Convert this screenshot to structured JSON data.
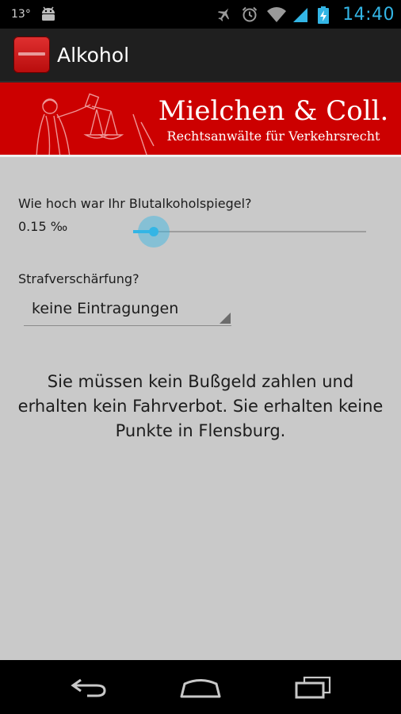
{
  "status_bar": {
    "temperature": "13°",
    "time": "14:40",
    "icons": [
      "android-icon",
      "airplane-mode-icon",
      "alarm-icon",
      "wifi-icon",
      "signal-icon",
      "battery-charging-icon"
    ],
    "accent_color": "#33b5e5"
  },
  "action_bar": {
    "title": "Alkohol",
    "icon": "app-icon"
  },
  "banner": {
    "firm_name": "Mielchen & Coll.",
    "firm_subtitle": "Rechtsanwälte für Verkehrsrecht",
    "background_color": "#cc0000",
    "image": "justitia-statue"
  },
  "form": {
    "blood_alcohol_question": "Wie hoch war Ihr Blutalkoholspiegel?",
    "blood_alcohol_value": "0.15 ‰",
    "slider_fraction": 0.09,
    "penalty_question": "Strafverschärfung?",
    "penalty_selected": "keine Eintragungen"
  },
  "result_text": "Sie müssen kein Bußgeld zahlen und erhalten kein Fahrverbot. Sie erhalten keine Punkte in Flensburg.",
  "nav_bar": {
    "buttons": [
      "back-icon",
      "home-icon",
      "recent-apps-icon"
    ]
  }
}
